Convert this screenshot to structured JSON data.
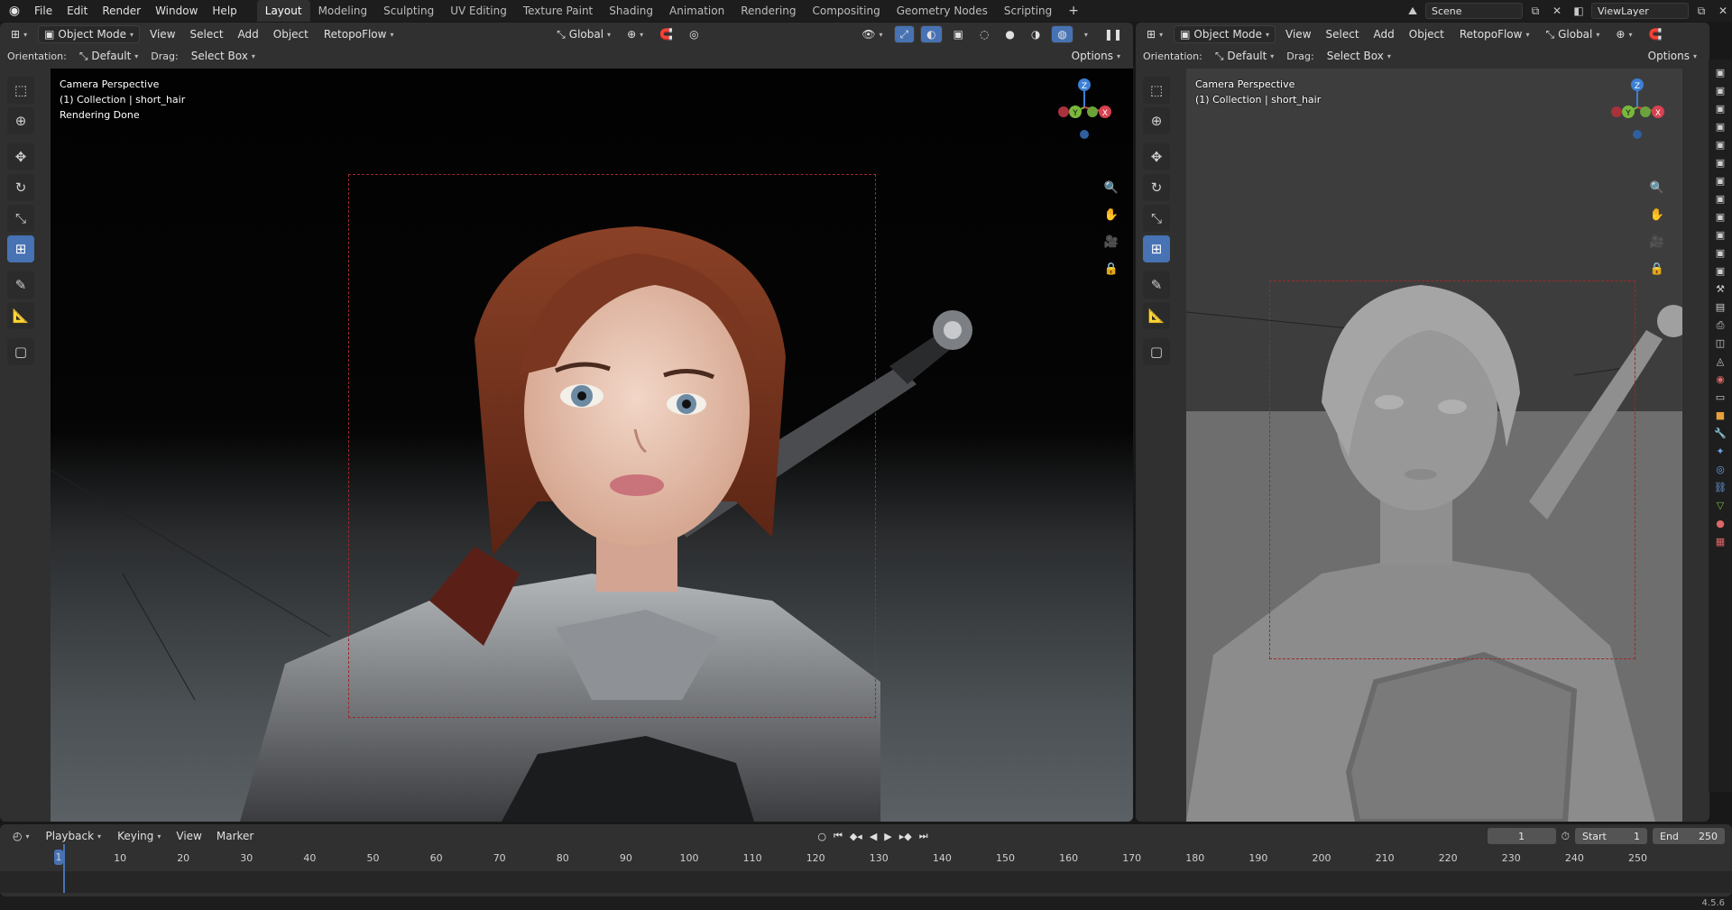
{
  "app": {
    "menus": [
      "File",
      "Edit",
      "Render",
      "Window",
      "Help"
    ],
    "workspaces": [
      "Layout",
      "Modeling",
      "Sculpting",
      "UV Editing",
      "Texture Paint",
      "Shading",
      "Animation",
      "Rendering",
      "Compositing",
      "Geometry Nodes",
      "Scripting"
    ],
    "active_workspace": "Layout",
    "scene": "Scene",
    "view_layer": "ViewLayer"
  },
  "left_viewport": {
    "mode": "Object Mode",
    "menus": [
      "View",
      "Select",
      "Add",
      "Object"
    ],
    "addon": "RetopoFlow",
    "transform_orientation": "Global",
    "orientation_label": "Orientation:",
    "orientation_value": "Default",
    "drag_label": "Drag:",
    "drag_value": "Select Box",
    "options": "Options",
    "overlay_lines": [
      "Camera Perspective",
      "(1) Collection | short_hair",
      "Rendering Done"
    ],
    "shading": "rendered"
  },
  "right_viewport": {
    "mode": "Object Mode",
    "menus": [
      "View",
      "Select",
      "Add",
      "Object"
    ],
    "addon": "RetopoFlow",
    "transform_orientation": "Global",
    "orientation_label": "Orientation:",
    "orientation_value": "Default",
    "drag_label": "Drag:",
    "drag_value": "Select Box",
    "options": "Options",
    "overlay_lines": [
      "Camera Perspective",
      "(1) Collection | short_hair"
    ],
    "shading": "solid"
  },
  "gizmo": {
    "z": "Z",
    "y": "Y",
    "x": "X"
  },
  "tools": [
    "select-box",
    "cursor",
    "move",
    "rotate",
    "scale",
    "transform",
    "annotate",
    "measure",
    "add-cube"
  ],
  "active_tool": "transform",
  "timeline": {
    "menus": [
      "Playback",
      "Keying",
      "View",
      "Marker"
    ],
    "current_frame": "1",
    "start_label": "Start",
    "start": "1",
    "end_label": "End",
    "end": "250",
    "ticks": [
      "10",
      "20",
      "30",
      "40",
      "50",
      "60",
      "70",
      "80",
      "90",
      "100",
      "110",
      "120",
      "130",
      "140",
      "150",
      "160",
      "170",
      "180",
      "190",
      "200",
      "210",
      "220",
      "230",
      "240",
      "250"
    ]
  },
  "status": {
    "version": "4.5.6"
  },
  "colors": {
    "accent": "#4772b3",
    "camera_frame": "#9b2a2a",
    "axis_x": "#d6424f",
    "axis_y": "#7ab83b",
    "axis_z": "#3b7fd6"
  }
}
